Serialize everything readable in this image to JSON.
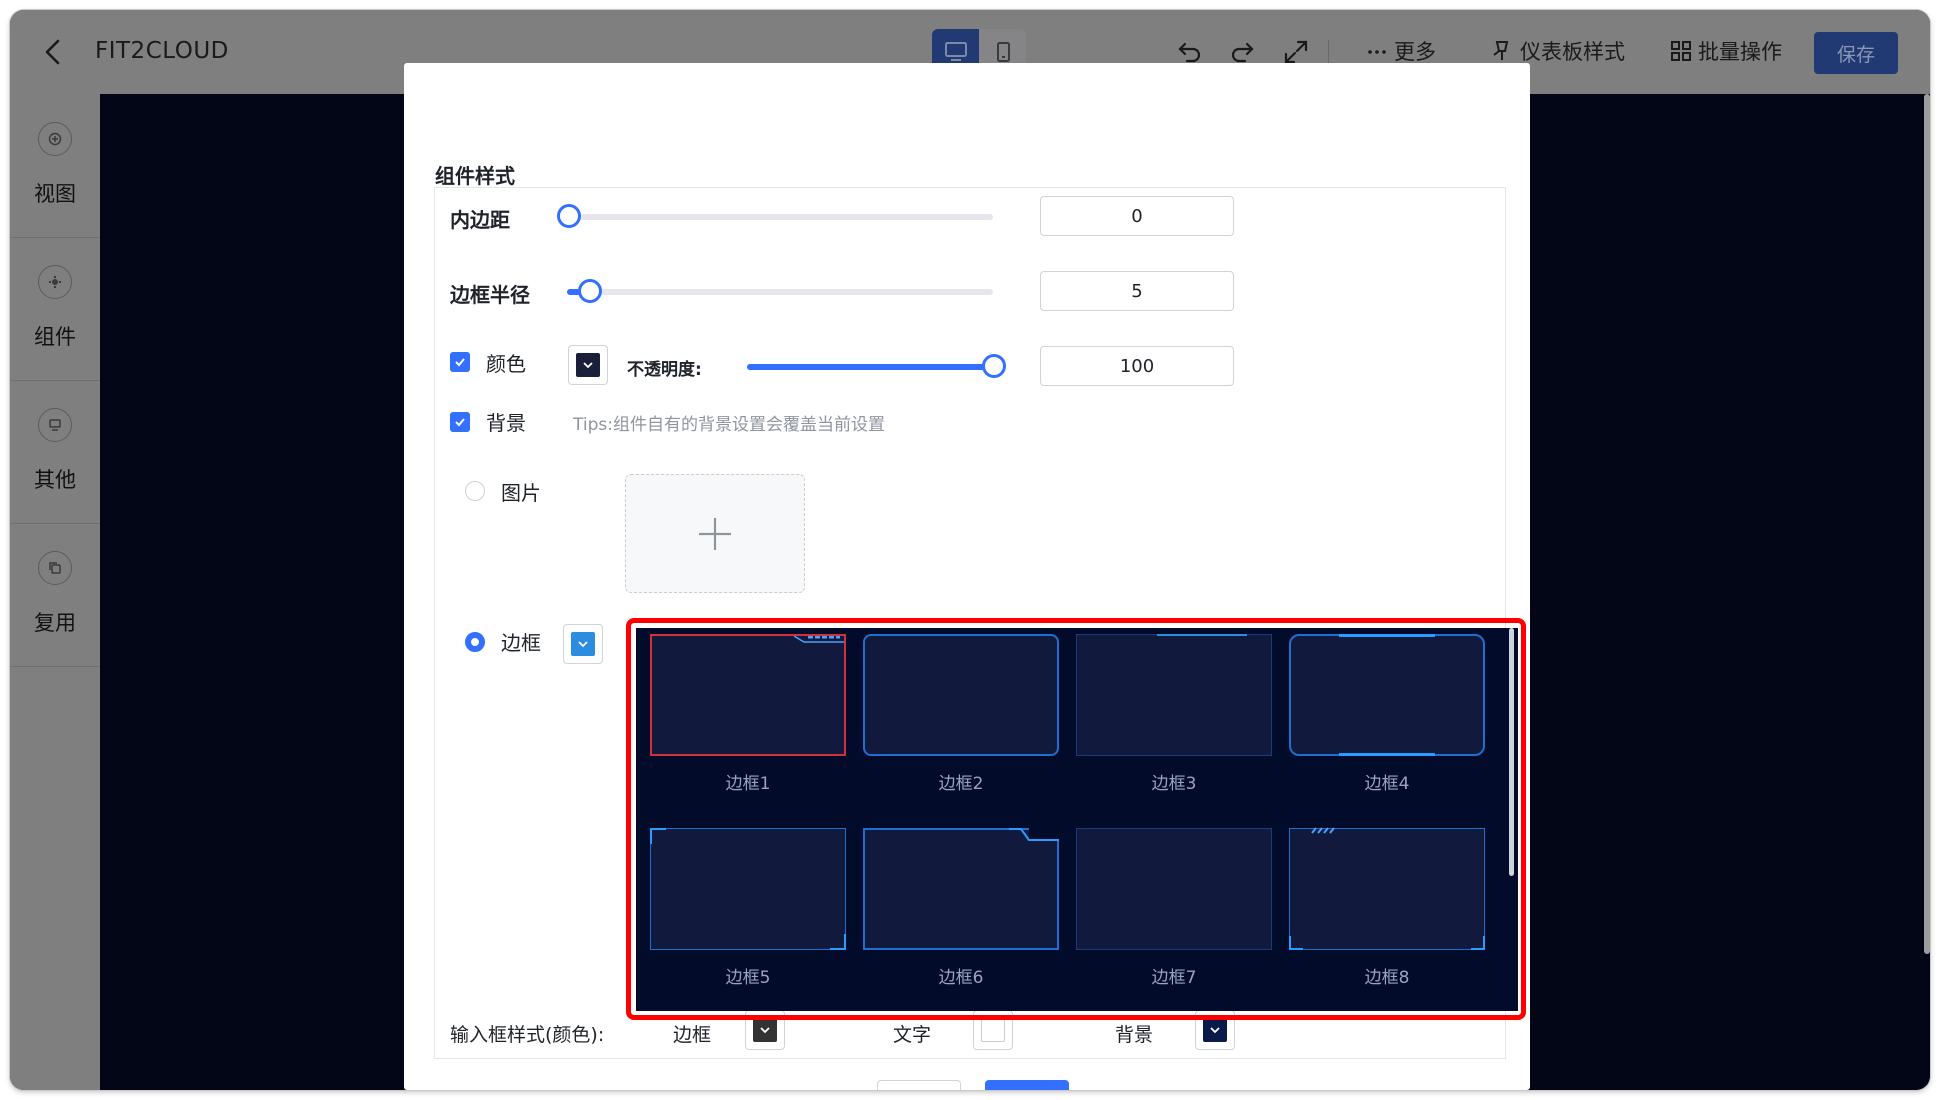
{
  "app": {
    "title": "FIT2CLOUD"
  },
  "toolbar": {
    "more": "更多",
    "dashboard_style": "仪表板样式",
    "batch_ops": "批量操作",
    "save": "保存"
  },
  "sidebar": {
    "items": [
      {
        "label": "视图",
        "icon": "view-icon"
      },
      {
        "label": "组件",
        "icon": "component-icon"
      },
      {
        "label": "其他",
        "icon": "other-icon"
      },
      {
        "label": "复用",
        "icon": "reuse-icon"
      }
    ]
  },
  "dialog": {
    "section_title": "组件样式",
    "padding": {
      "label": "内边距",
      "value": "0",
      "level": 0
    },
    "radius": {
      "label": "边框半径",
      "value": "5",
      "level": 0.05
    },
    "color": {
      "label": "颜色",
      "checked": true,
      "swatch": "#1a1f3a",
      "opacity_label": "不透明度:",
      "opacity_value": "100",
      "level": 1.0
    },
    "background": {
      "label": "背景",
      "checked": true,
      "tips": "Tips:组件自有的背景设置会覆盖当前设置"
    },
    "image_option": {
      "label": "图片",
      "selected": false
    },
    "border_option": {
      "label": "边框",
      "selected": true,
      "swatch": "#2b8ce0"
    },
    "borders": [
      "边框1",
      "边框2",
      "边框3",
      "边框4",
      "边框5",
      "边框6",
      "边框7",
      "边框8"
    ],
    "selected_border": "边框1",
    "input_style": {
      "label": "输入框样式(颜色):",
      "border_label": "边框",
      "text_label": "文字",
      "background_label": "背景",
      "border_swatch": "#333333",
      "text_swatch": "#ffffff",
      "background_swatch": "#0a1a4a"
    }
  },
  "colors": {
    "accent": "#3370ff",
    "highlight": "#ff0000",
    "canvas": "#030616",
    "border_line": "#1e90ff"
  }
}
